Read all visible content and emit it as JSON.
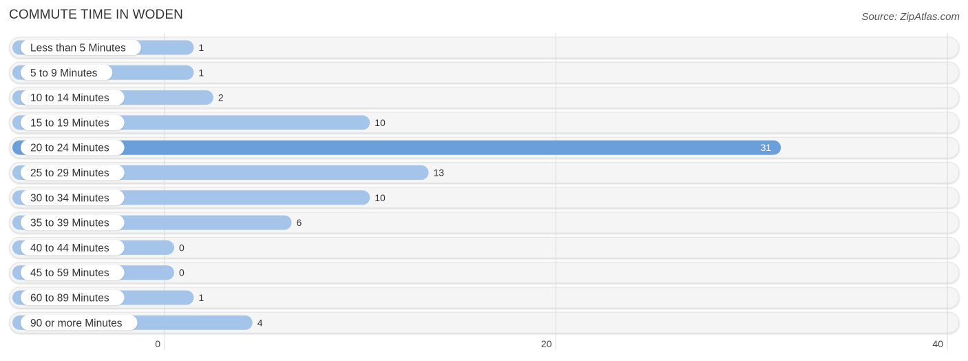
{
  "header": {
    "title": "COMMUTE TIME IN WODEN",
    "source": "Source: ZipAtlas.com"
  },
  "colors": {
    "bar": "#a4c4ea",
    "bar_highlight": "#6a9fdc",
    "track": "#f5f5f5",
    "grid": "#d9d9d9"
  },
  "chart_data": {
    "type": "bar",
    "orientation": "horizontal",
    "title": "COMMUTE TIME IN WODEN",
    "xlabel": "",
    "ylabel": "",
    "categories": [
      "Less than 5 Minutes",
      "5 to 9 Minutes",
      "10 to 14 Minutes",
      "15 to 19 Minutes",
      "20 to 24 Minutes",
      "25 to 29 Minutes",
      "30 to 34 Minutes",
      "35 to 39 Minutes",
      "40 to 44 Minutes",
      "45 to 59 Minutes",
      "60 to 89 Minutes",
      "90 or more Minutes"
    ],
    "values": [
      1,
      1,
      2,
      10,
      31,
      13,
      10,
      6,
      0,
      0,
      1,
      4
    ],
    "highlight_index": 4,
    "xlim": [
      0,
      40
    ],
    "xticks": [
      0,
      20,
      40
    ],
    "grid": true,
    "legend": "none"
  }
}
